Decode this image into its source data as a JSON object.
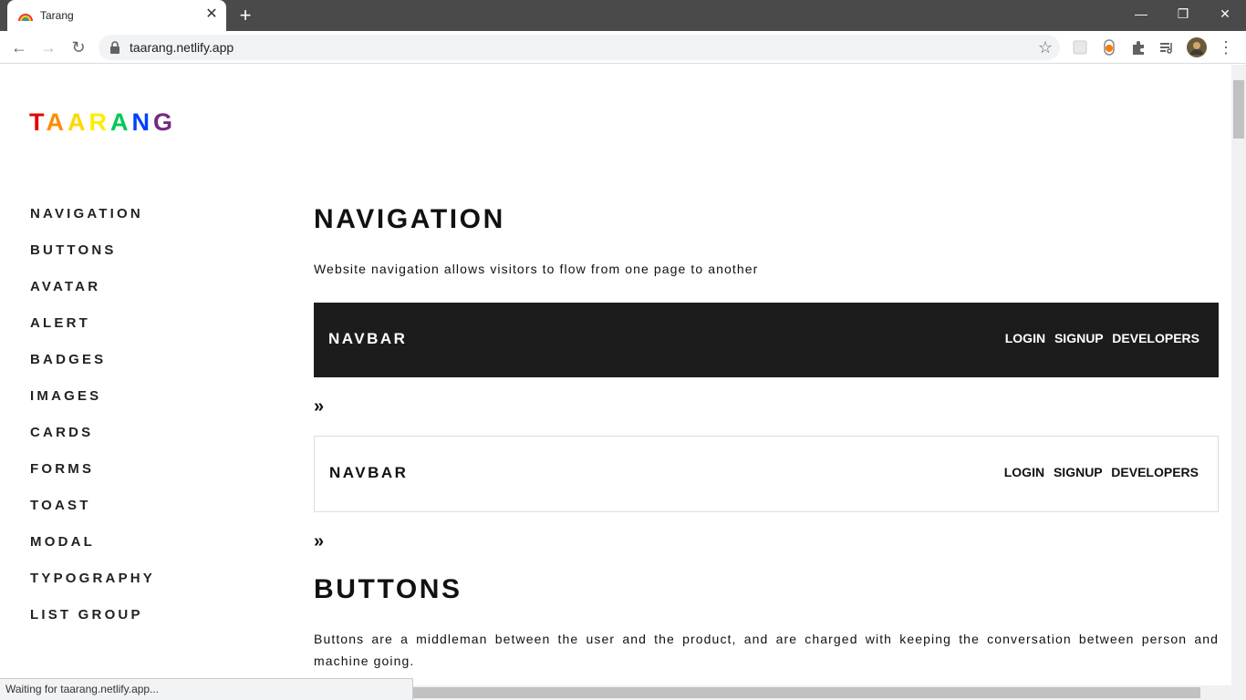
{
  "browser": {
    "tab_title": "Tarang",
    "url": "taarang.netlify.app",
    "status": "Waiting for taarang.netlify.app..."
  },
  "logo": {
    "letters": [
      "T",
      "A",
      "A",
      "R",
      "A",
      "N",
      "G"
    ],
    "colors": [
      "#e40303",
      "#ff8c00",
      "#ffd700",
      "#ffed00",
      "#00c853",
      "#0040ff",
      "#732982"
    ]
  },
  "sidebar": {
    "items": [
      {
        "label": "NAVIGATION"
      },
      {
        "label": "BUTTONS"
      },
      {
        "label": "AVATAR"
      },
      {
        "label": "ALERT"
      },
      {
        "label": "BADGES"
      },
      {
        "label": "IMAGES"
      },
      {
        "label": "CARDS"
      },
      {
        "label": "FORMS"
      },
      {
        "label": "TOAST"
      },
      {
        "label": "MODAL"
      },
      {
        "label": "TYPOGRAPHY"
      },
      {
        "label": "LIST GROUP"
      }
    ]
  },
  "sections": {
    "navigation": {
      "title": "NAVIGATION",
      "description": "Website navigation allows visitors to flow from one page to another",
      "navbar_dark": {
        "brand": "NAVBAR",
        "links": [
          "LOGIN",
          "SIGNUP",
          "DEVELOPERS"
        ]
      },
      "navbar_light": {
        "brand": "NAVBAR",
        "links": [
          "LOGIN",
          "SIGNUP",
          "DEVELOPERS"
        ]
      },
      "more": "»"
    },
    "buttons": {
      "title": "BUTTONS",
      "description": "Buttons are a middleman between the user and the product, and are charged with keeping the conversation between person and machine going."
    }
  }
}
